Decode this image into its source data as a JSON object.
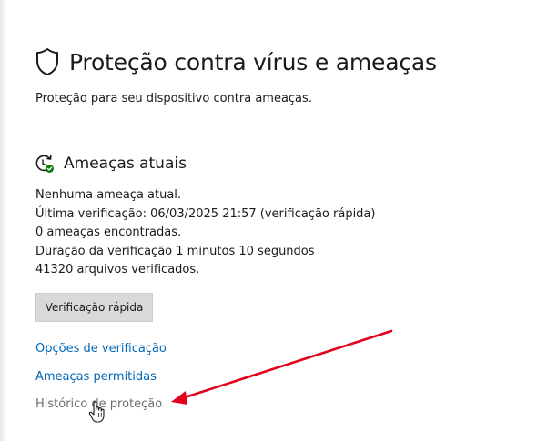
{
  "header": {
    "title": "Proteção contra vírus e ameaças",
    "icon": "shield-icon"
  },
  "subtitle": "Proteção para seu dispositivo contra ameaças.",
  "current_threats": {
    "icon": "refresh-check-icon",
    "title": "Ameaças atuais",
    "lines": [
      "Nenhuma ameaça atual.",
      "Última verificação: 06/03/2025 21:57 (verificação rápida)",
      "0 ameaças encontradas.",
      "Duração da verificação 1 minutos 10 segundos",
      "41320 arquivos verificados."
    ],
    "quick_scan_label": "Verificação rápida"
  },
  "links": {
    "scan_options": "Opções de verificação",
    "allowed_threats": "Ameaças permitidas",
    "protection_history": "Histórico de proteção"
  },
  "colors": {
    "link": "#0067b8",
    "link_hover": "#6e6e6e",
    "button_bg": "#d9d9d9",
    "annotation_arrow": "#e3001b",
    "status_ok": "#107c10"
  },
  "overlays": {
    "annotation": "red-arrow-icon",
    "cursor": "hand-pointer-icon"
  }
}
